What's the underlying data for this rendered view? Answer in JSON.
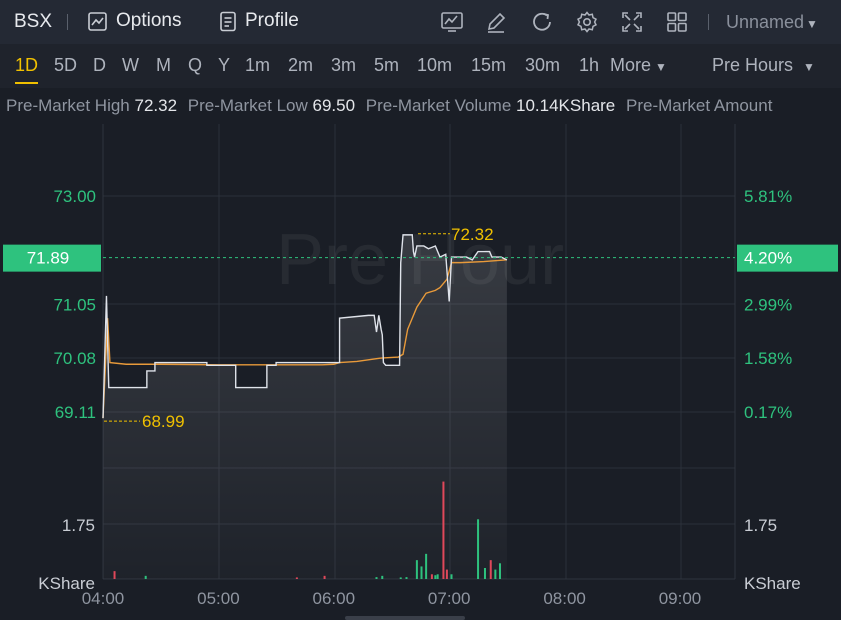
{
  "symbol": "BSX",
  "toolbar": {
    "options_label": "Options",
    "profile_label": "Profile",
    "layout_name": "Unnamed"
  },
  "periods": [
    {
      "label": "1D",
      "active": true
    },
    {
      "label": "5D"
    },
    {
      "label": "D"
    },
    {
      "label": "W"
    },
    {
      "label": "M"
    },
    {
      "label": "Q"
    },
    {
      "label": "Y"
    },
    {
      "label": "1m"
    },
    {
      "label": "2m"
    },
    {
      "label": "3m"
    },
    {
      "label": "5m"
    },
    {
      "label": "10m"
    },
    {
      "label": "15m"
    },
    {
      "label": "30m"
    },
    {
      "label": "1h"
    }
  ],
  "more_label": "More",
  "session_label": "Pre Hours",
  "stats": {
    "high_label": "Pre-Market High",
    "high_value": "72.32",
    "low_label": "Pre-Market Low",
    "low_value": "69.50",
    "volume_label": "Pre-Market Volume",
    "volume_value": "10.14KShare",
    "amount_label": "Pre-Market Amount"
  },
  "chart_data": {
    "type": "line",
    "watermark": "Pre Hour",
    "last_price": "71.89",
    "last_pct": "4.20%",
    "price_ticks": [
      "73.00",
      "71.05",
      "70.08",
      "69.11"
    ],
    "price_tick_values": [
      73.0,
      71.05,
      70.08,
      69.11
    ],
    "pct_ticks": [
      "5.81%",
      "2.99%",
      "1.58%",
      "0.17%"
    ],
    "high_annotation": "72.32",
    "low_annotation": "68.99",
    "volume_tick": "1.75",
    "volume_unit": "KShare",
    "x_ticks": [
      "04:00",
      "05:00",
      "06:00",
      "07:00",
      "08:00",
      "09:00"
    ],
    "x_tick_hours": [
      4,
      5,
      6,
      7,
      8,
      9
    ],
    "x_range": [
      4,
      9.5
    ],
    "y_range": [
      68.6,
      74.0
    ],
    "colors": {
      "price": "#dfe3ea",
      "average": "#e89a3a",
      "up": "#2ec27e",
      "down": "#e0485a",
      "accent": "#f0c000"
    },
    "price_series": [
      [
        4.0,
        69.0
      ],
      [
        4.03,
        71.2
      ],
      [
        4.05,
        69.55
      ],
      [
        4.1,
        69.55
      ],
      [
        4.2,
        69.55
      ],
      [
        4.3,
        69.55
      ],
      [
        4.38,
        69.55
      ],
      [
        4.38,
        69.85
      ],
      [
        4.45,
        69.85
      ],
      [
        4.45,
        70.0
      ],
      [
        4.6,
        70.0
      ],
      [
        4.8,
        70.0
      ],
      [
        4.9,
        70.0
      ],
      [
        4.9,
        69.95
      ],
      [
        5.15,
        69.95
      ],
      [
        5.15,
        69.55
      ],
      [
        5.42,
        69.55
      ],
      [
        5.42,
        69.95
      ],
      [
        5.5,
        69.95
      ],
      [
        5.5,
        70.0
      ],
      [
        5.8,
        70.0
      ],
      [
        6.0,
        70.0
      ],
      [
        6.05,
        70.0
      ],
      [
        6.05,
        70.8
      ],
      [
        6.3,
        70.85
      ],
      [
        6.35,
        70.85
      ],
      [
        6.37,
        70.55
      ],
      [
        6.39,
        70.85
      ],
      [
        6.41,
        70.6
      ],
      [
        6.42,
        70.5
      ],
      [
        6.43,
        70.0
      ],
      [
        6.45,
        69.95
      ],
      [
        6.57,
        69.95
      ],
      [
        6.58,
        71.8
      ],
      [
        6.6,
        72.3
      ],
      [
        6.68,
        72.3
      ],
      [
        6.69,
        72.0
      ],
      [
        6.7,
        71.9
      ],
      [
        6.72,
        72.1
      ],
      [
        6.78,
        72.1
      ],
      [
        6.82,
        72.05
      ],
      [
        6.88,
        72.1
      ],
      [
        6.92,
        71.9
      ],
      [
        6.97,
        71.95
      ],
      [
        7.0,
        71.1
      ],
      [
        7.02,
        71.9
      ],
      [
        7.15,
        71.9
      ],
      [
        7.2,
        71.85
      ],
      [
        7.25,
        72.0
      ],
      [
        7.35,
        72.0
      ],
      [
        7.37,
        71.9
      ],
      [
        7.45,
        71.9
      ],
      [
        7.5,
        71.85
      ]
    ],
    "average_series": [
      [
        4.0,
        69.0
      ],
      [
        4.04,
        70.8
      ],
      [
        4.06,
        70.0
      ],
      [
        4.2,
        69.97
      ],
      [
        4.5,
        69.97
      ],
      [
        5.0,
        69.96
      ],
      [
        5.5,
        69.96
      ],
      [
        5.9,
        69.96
      ],
      [
        6.0,
        69.97
      ],
      [
        6.05,
        70.0
      ],
      [
        6.2,
        70.02
      ],
      [
        6.4,
        70.08
      ],
      [
        6.56,
        70.1
      ],
      [
        6.6,
        70.15
      ],
      [
        6.64,
        70.6
      ],
      [
        6.72,
        71.0
      ],
      [
        6.8,
        71.25
      ],
      [
        6.88,
        71.3
      ],
      [
        6.92,
        71.35
      ],
      [
        6.98,
        71.5
      ],
      [
        7.02,
        71.8
      ],
      [
        7.1,
        71.8
      ],
      [
        7.3,
        71.82
      ],
      [
        7.5,
        71.85
      ]
    ],
    "volume_bars": [
      {
        "t": 4.1,
        "v": 0.25,
        "dir": "down"
      },
      {
        "t": 4.37,
        "v": 0.1,
        "dir": "up"
      },
      {
        "t": 5.68,
        "v": 0.05,
        "dir": "down"
      },
      {
        "t": 5.92,
        "v": 0.1,
        "dir": "down"
      },
      {
        "t": 6.37,
        "v": 0.06,
        "dir": "up"
      },
      {
        "t": 6.42,
        "v": 0.1,
        "dir": "up"
      },
      {
        "t": 6.58,
        "v": 0.05,
        "dir": "up"
      },
      {
        "t": 6.63,
        "v": 0.06,
        "dir": "up"
      },
      {
        "t": 6.72,
        "v": 0.6,
        "dir": "up"
      },
      {
        "t": 6.76,
        "v": 0.4,
        "dir": "up"
      },
      {
        "t": 6.8,
        "v": 0.8,
        "dir": "up"
      },
      {
        "t": 6.85,
        "v": 0.15,
        "dir": "down"
      },
      {
        "t": 6.88,
        "v": 0.12,
        "dir": "up"
      },
      {
        "t": 6.9,
        "v": 0.15,
        "dir": "up"
      },
      {
        "t": 6.95,
        "v": 3.1,
        "dir": "down"
      },
      {
        "t": 6.98,
        "v": 0.3,
        "dir": "down"
      },
      {
        "t": 7.02,
        "v": 0.15,
        "dir": "up"
      },
      {
        "t": 7.25,
        "v": 1.9,
        "dir": "up"
      },
      {
        "t": 7.31,
        "v": 0.35,
        "dir": "up"
      },
      {
        "t": 7.36,
        "v": 0.6,
        "dir": "down"
      },
      {
        "t": 7.4,
        "v": 0.3,
        "dir": "up"
      },
      {
        "t": 7.44,
        "v": 0.5,
        "dir": "up"
      }
    ]
  }
}
